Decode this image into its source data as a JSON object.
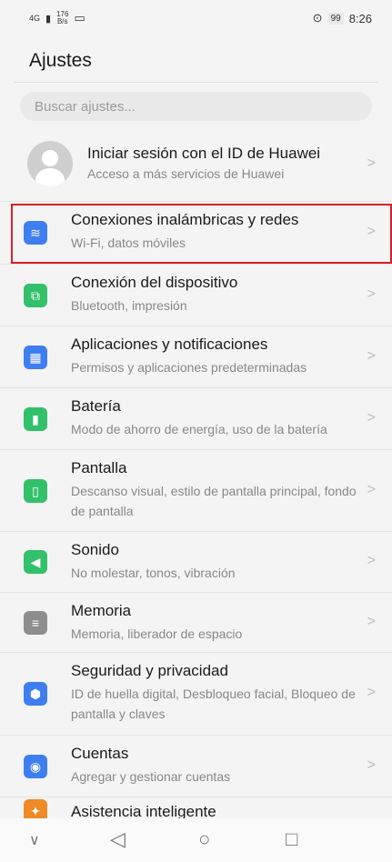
{
  "status": {
    "signal": "4G",
    "speed_value": "176",
    "speed_unit": "B/s",
    "battery": "99",
    "time": "8:26"
  },
  "header": {
    "title": "Ajustes"
  },
  "search": {
    "placeholder": "Buscar ajustes..."
  },
  "account": {
    "title": "Iniciar sesión con el ID de Huawei",
    "subtitle": "Acceso a más servicios de Huawei"
  },
  "items": [
    {
      "title": "Conexiones inalámbricas y redes",
      "subtitle": "Wi-Fi, datos móviles",
      "icon": "wifi-icon",
      "color": "#3f7ef0"
    },
    {
      "title": "Conexión del dispositivo",
      "subtitle": "Bluetooth, impresión",
      "icon": "device-connection-icon",
      "color": "#33c06b"
    },
    {
      "title": "Aplicaciones y notificaciones",
      "subtitle": "Permisos y aplicaciones predeterminadas",
      "icon": "apps-grid-icon",
      "color": "#3f7ef0"
    },
    {
      "title": "Batería",
      "subtitle": "Modo de ahorro de energía, uso de la batería",
      "icon": "battery-icon",
      "color": "#33c06b"
    },
    {
      "title": "Pantalla",
      "subtitle": "Descanso visual, estilo de pantalla principal, fondo de pantalla",
      "icon": "display-icon",
      "color": "#33c06b"
    },
    {
      "title": "Sonido",
      "subtitle": "No molestar, tonos, vibración",
      "icon": "sound-icon",
      "color": "#33c06b"
    },
    {
      "title": "Memoria",
      "subtitle": "Memoria, liberador de espacio",
      "icon": "storage-icon",
      "color": "#8d8d8d"
    },
    {
      "title": "Seguridad y privacidad",
      "subtitle": "ID de huella digital, Desbloqueo facial, Bloqueo de pantalla y claves",
      "icon": "shield-icon",
      "color": "#3f7ef0"
    },
    {
      "title": "Cuentas",
      "subtitle": "Agregar y gestionar cuentas",
      "icon": "account-icon",
      "color": "#3f7ef0"
    },
    {
      "title": "Asistencia inteligente",
      "subtitle": "",
      "icon": "assist-icon",
      "color": "#f08a24"
    }
  ],
  "navbar": {
    "down": "chevron-down-icon",
    "back": "back-icon",
    "home": "home-icon",
    "recents": "recents-icon"
  }
}
